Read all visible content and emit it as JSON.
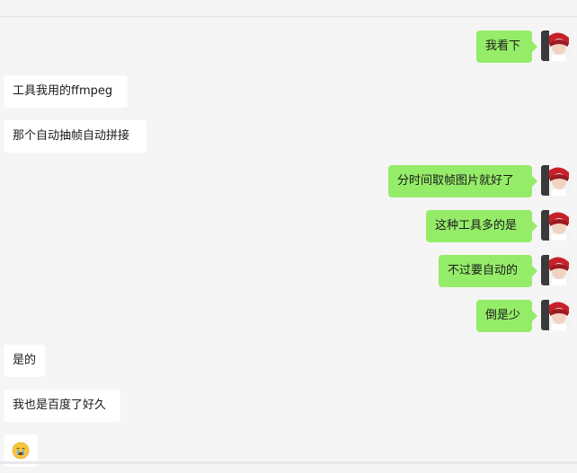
{
  "messages": [
    {
      "side": "right",
      "text": "我看下"
    },
    {
      "side": "left",
      "text": "工具我用的ffmpeg"
    },
    {
      "side": "left",
      "text": "那个自动抽帧自动拼接"
    },
    {
      "side": "right",
      "text": "分时间取帧图片就好了"
    },
    {
      "side": "right",
      "text": "这种工具多的是"
    },
    {
      "side": "right",
      "text": "不过要自动的"
    },
    {
      "side": "right",
      "text": "倒是少"
    },
    {
      "side": "left",
      "text": "是的"
    },
    {
      "side": "left",
      "text": "我也是百度了好久"
    },
    {
      "side": "left",
      "emoji": "crying-face-icon"
    }
  ]
}
